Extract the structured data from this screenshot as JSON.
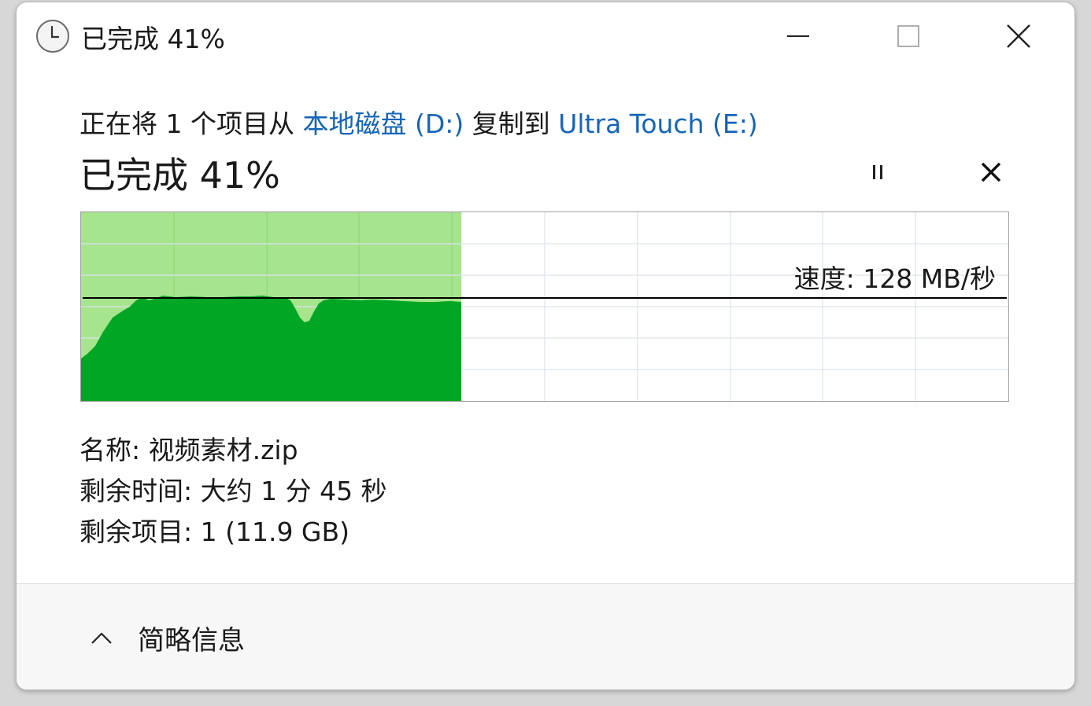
{
  "window": {
    "title": "已完成 41%",
    "icons": {
      "app": "clock-icon",
      "minimize": "minimize-icon",
      "maximize": "maximize-icon",
      "close": "close-icon"
    }
  },
  "copy": {
    "prefix": "正在将 1 个项目从 ",
    "source": "本地磁盘 (D:)",
    "middle": " 复制到 ",
    "destination": "Ultra Touch (E:)"
  },
  "progress": {
    "title": "已完成 41%",
    "percent": 41,
    "pause_icon": "pause-icon",
    "cancel_icon": "cancel-icon"
  },
  "graph": {
    "speed_label": "速度: 128 MB/秒",
    "colors": {
      "filled_area": "#00a624",
      "progress_background": "#a6e48e",
      "grid_line": "#dde3ea",
      "speed_line": "#000000"
    }
  },
  "details": {
    "name": "名称: 视频素材.zip",
    "time_remaining": "剩余时间: 大约 1 分 45 秒",
    "items_remaining": "剩余项目: 1 (11.9 GB)"
  },
  "footer": {
    "toggle_label": "简略信息",
    "toggle_icon": "chevron-up-icon"
  }
}
